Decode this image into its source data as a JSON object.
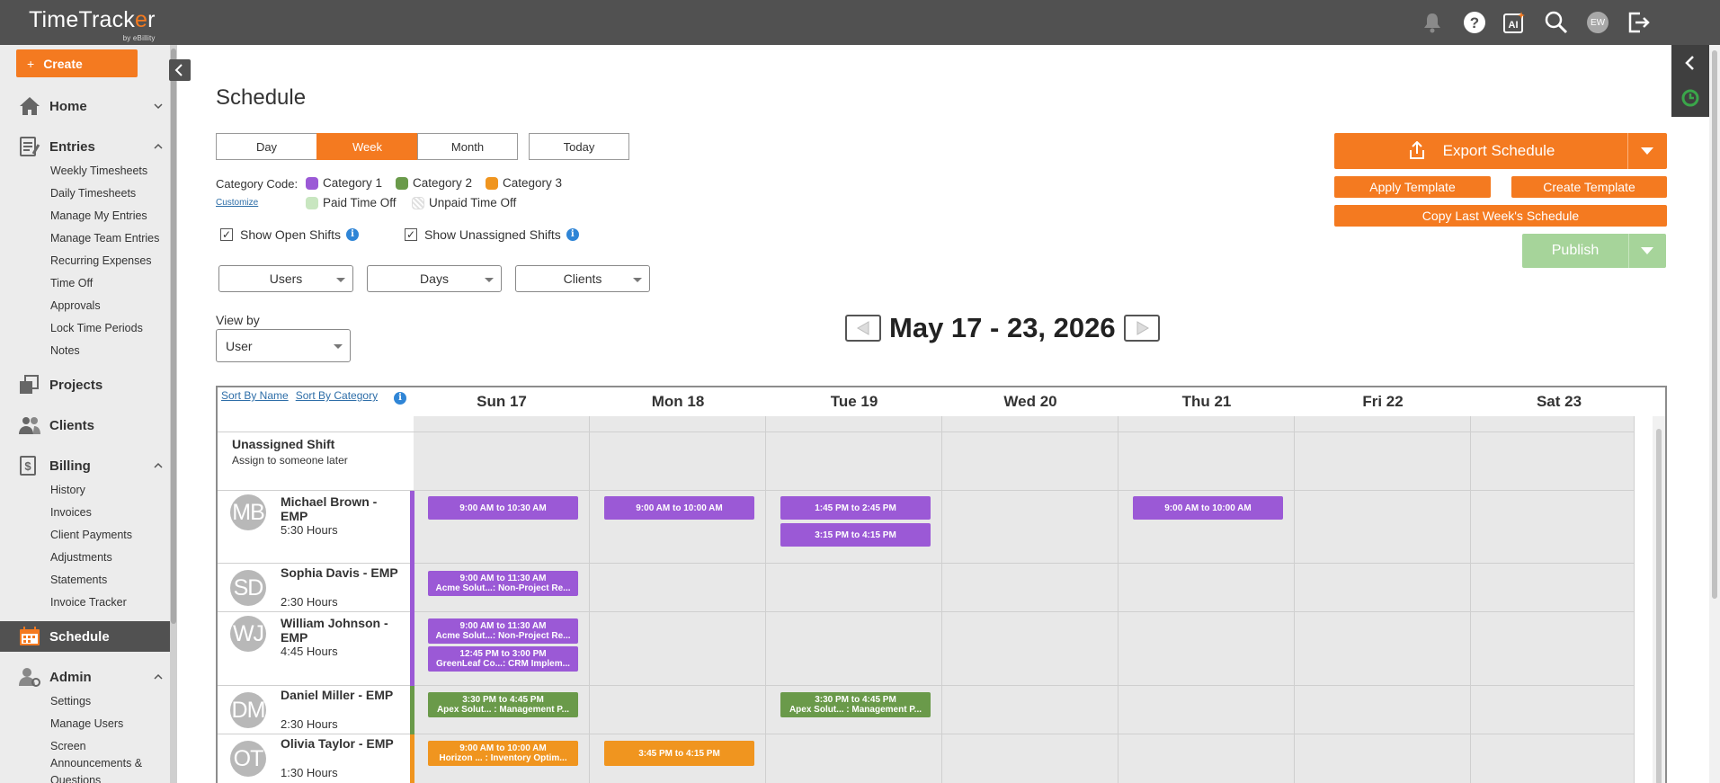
{
  "app": {
    "logo_main": "TimeTrack",
    "logo_o": "e",
    "logo_end": "r",
    "logo_by": "by eBillity"
  },
  "topbar": {
    "avatar_initials": "EW"
  },
  "sidebar": {
    "create_label": "Create",
    "sections": [
      {
        "label": "Home"
      },
      {
        "label": "Entries"
      },
      {
        "label": "Projects"
      },
      {
        "label": "Clients"
      },
      {
        "label": "Billing"
      },
      {
        "label": "Schedule"
      },
      {
        "label": "Admin"
      }
    ],
    "entries_items": [
      "Weekly Timesheets",
      "Daily Timesheets",
      "Manage My Entries",
      "Manage Team Entries",
      "Recurring Expenses",
      "Time Off",
      "Approvals",
      "Lock Time Periods",
      "Notes"
    ],
    "billing_items": [
      "History",
      "Invoices",
      "Client Payments",
      "Adjustments",
      "Statements",
      "Invoice Tracker"
    ],
    "admin_items": [
      "Settings",
      "Manage Users",
      "Screen",
      "Announcements &",
      "Questions"
    ]
  },
  "page": {
    "title": "Schedule",
    "views": [
      "Day",
      "Week",
      "Month"
    ],
    "selected_view": "Week",
    "today_label": "Today",
    "category_code_label": "Category Code:",
    "customize_label": "Customize",
    "categories": [
      {
        "label": "Category 1",
        "color": "#9b59d6"
      },
      {
        "label": "Category 2",
        "color": "#6a9a4a"
      },
      {
        "label": "Category 3",
        "color": "#f0951f"
      },
      {
        "label": "Paid Time Off",
        "color": "#c8e6c0"
      },
      {
        "label": "Unpaid Time Off",
        "color": "#e6e6e6"
      }
    ],
    "show_open_shifts": "Show Open Shifts",
    "show_unassigned_shifts": "Show Unassigned Shifts",
    "filters": {
      "users": "Users",
      "days": "Days",
      "clients": "Clients"
    },
    "view_by_label": "View by",
    "view_by_value": "User",
    "date_range": "May 17 - 23, 2026",
    "export_label": "Export Schedule",
    "apply_template": "Apply Template",
    "create_template": "Create Template",
    "copy_last_week": "Copy Last Week's Schedule",
    "publish_label": "Publish"
  },
  "grid": {
    "sort_by_name": "Sort By Name",
    "sort_by_category": "Sort By Category",
    "days": [
      "Sun 17",
      "Mon 18",
      "Tue 19",
      "Wed 20",
      "Thu 21",
      "Fri 22",
      "Sat 23"
    ],
    "unassigned": {
      "title": "Unassigned Shift",
      "subtitle": "Assign to someone later"
    },
    "users": [
      {
        "initials": "MB",
        "name": "Michael Brown - EMP",
        "hours": "5:30 Hours",
        "bar_color": "#9b59d6"
      },
      {
        "initials": "SD",
        "name": "Sophia Davis - EMP",
        "hours": "2:30 Hours",
        "bar_color": "#9b59d6"
      },
      {
        "initials": "WJ",
        "name": "William Johnson - EMP",
        "hours": "4:45 Hours",
        "bar_color": "#9b59d6"
      },
      {
        "initials": "DM",
        "name": "Daniel Miller - EMP",
        "hours": "2:30 Hours",
        "bar_color": "#6a9a4a"
      },
      {
        "initials": "OT",
        "name": "Olivia Taylor - EMP",
        "hours": "1:30 Hours",
        "bar_color": "#f0951f"
      }
    ],
    "shifts": [
      {
        "time": "9:00 AM to 10:30 AM",
        "detail": ""
      },
      {
        "time": "9:00 AM to 10:00 AM",
        "detail": ""
      },
      {
        "time": "1:45 PM to 2:45 PM",
        "detail": ""
      },
      {
        "time": "3:15 PM to 4:15 PM",
        "detail": ""
      },
      {
        "time": "9:00 AM to 10:00 AM",
        "detail": ""
      },
      {
        "time": "9:00 AM to 11:30 AM",
        "detail": "Acme Solut...: Non-Project Re..."
      },
      {
        "time": "9:00 AM to 11:30 AM",
        "detail": "Acme Solut...: Non-Project Re..."
      },
      {
        "time": "12:45 PM to 3:00 PM",
        "detail": "GreenLeaf Co...: CRM Implem..."
      },
      {
        "time": "3:30 PM to 4:45 PM",
        "detail": "Apex Solut... : Management P..."
      },
      {
        "time": "3:30 PM to 4:45 PM",
        "detail": "Apex Solut... : Management P..."
      },
      {
        "time": "9:00 AM to 10:00 AM",
        "detail": "Horizon ... : Inventory Optim..."
      },
      {
        "time": "3:45 PM to 4:15 PM",
        "detail": ""
      }
    ]
  }
}
